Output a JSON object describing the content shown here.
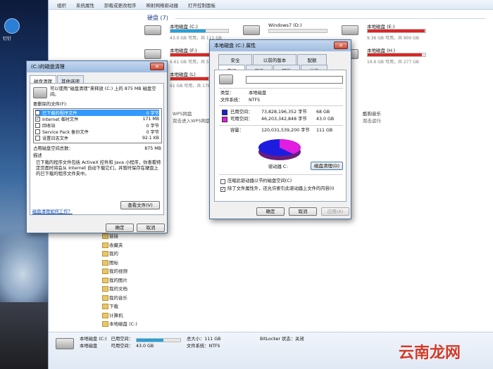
{
  "desktop": {
    "icon_label": "钉钉"
  },
  "explorer": {
    "menu": [
      "组织",
      "系统属性",
      "卸载或更改程序",
      "映射网络驱动器",
      "打开控制面板"
    ],
    "group_title": "硬盘 (7)",
    "drives": [
      {
        "name": "本地磁盘 (C:)",
        "free": "43.0 GB 可用，共 111 GB",
        "fill": 0.61,
        "color": "blue"
      },
      {
        "name": "Windows7 (D:)",
        "free": "",
        "fill": 0.0,
        "color": "blue"
      },
      {
        "name": "本地磁盘 (E:)",
        "free": "9.36 GB 可用，共 900 GB",
        "fill": 0.99,
        "color": "red"
      },
      {
        "name": "本地磁盘 (F:)",
        "free": "6.61 GB 可用，共 55.6 GB",
        "fill": 0.88,
        "color": "red"
      },
      {
        "name": "本地磁盘 (H:)",
        "free": "16.6 GB 可用，共 277 GB",
        "fill": 0.94,
        "color": "red"
      },
      {
        "name": "本地磁盘 (L)",
        "free": "61 GB 可用，共 178 GB",
        "fill": 0.66,
        "color": "red"
      }
    ],
    "other_items": [
      "WPS网盘",
      "双击进入WPS网盘",
      "酷狗音乐",
      "双击运行"
    ],
    "nav_items": [
      "链接",
      "收藏夹",
      "我的",
      "图标",
      "我的视频",
      "我的图片",
      "我的文档",
      "我的音乐",
      "下载",
      "计算机",
      "本地磁盘 (C:)"
    ],
    "status": {
      "drive_name": "本地磁盘 (C:)",
      "role": "本地磁盘",
      "used_label": "已用空间：",
      "free_label": "可用空间：",
      "free_value": "43.0 GB",
      "total_label": "总大小：111 GB",
      "fs_label": "文件系统：NTFS",
      "bitlocker": "BitLocker 状态：关闭"
    }
  },
  "cleanup": {
    "title": "(C:)的磁盘清理",
    "tabs": [
      "磁盘清理",
      "其他选项"
    ],
    "intro": "可以使用“磁盘清理”来释放 (C:) 上的 875 MB 磁盘空间。",
    "files_label": "要删除的文件(F):",
    "rows": [
      {
        "checked": "✓",
        "name": "已下载的程序文件",
        "size": "0 字节",
        "selected": true
      },
      {
        "checked": "✓",
        "name": "Internet 临时文件",
        "size": "171 MB",
        "selected": false
      },
      {
        "checked": "",
        "name": "回收站",
        "size": "0 字节",
        "selected": false
      },
      {
        "checked": "",
        "name": "Service Pack 备份文件",
        "size": "0 字节",
        "selected": false
      },
      {
        "checked": "",
        "name": "设置日志文件",
        "size": "92.1 KB",
        "selected": false
      }
    ],
    "total_label": "占用磁盘空间总数：",
    "total_value": "875 MB",
    "desc_label": "描述",
    "desc_text": "已下载的程序文件包括 ActiveX 控件和 Java 小程序，你查看特定页面时将会从 Internet 自动下载它们，并暂时保存在硬盘上的已下载的程序文件夹中。",
    "view_files": "查看文件(V)",
    "link": "磁盘清理如何工作？",
    "ok": "确定",
    "cancel": "取消"
  },
  "props": {
    "title": "本地磁盘 (C:) 属性",
    "tabs_top": [
      "安全",
      "以前的版本",
      "配额"
    ],
    "tabs_bottom": [
      "常规",
      "工具",
      "硬件",
      "共享"
    ],
    "type_label": "类型：",
    "type_value": "本地磁盘",
    "fs_label": "文件系统：",
    "fs_value": "NTFS",
    "used_label": "已用空间：",
    "used_bytes": "73,828,196,352 字节",
    "used_gb": "68 GB",
    "free_label": "可用空间：",
    "free_bytes": "46,203,342,848 字节",
    "free_gb": "43.0 GB",
    "cap_label": "容量：",
    "cap_bytes": "120,031,539,200 字节",
    "cap_gb": "111 GB",
    "drive_label": "驱动器 C:",
    "cleanup_btn": "磁盘清理(D)",
    "compress": "压缩此驱动器以节约磁盘空间(C)",
    "index": "除了文件属性外，还允许索引此驱动器上文件的内容(I)",
    "index_check": "✓",
    "ok": "确定",
    "cancel": "取消",
    "apply": "应用(A)",
    "used_color": "#1d1de0",
    "free_color": "#e01de0"
  },
  "watermark": "云南龙网"
}
